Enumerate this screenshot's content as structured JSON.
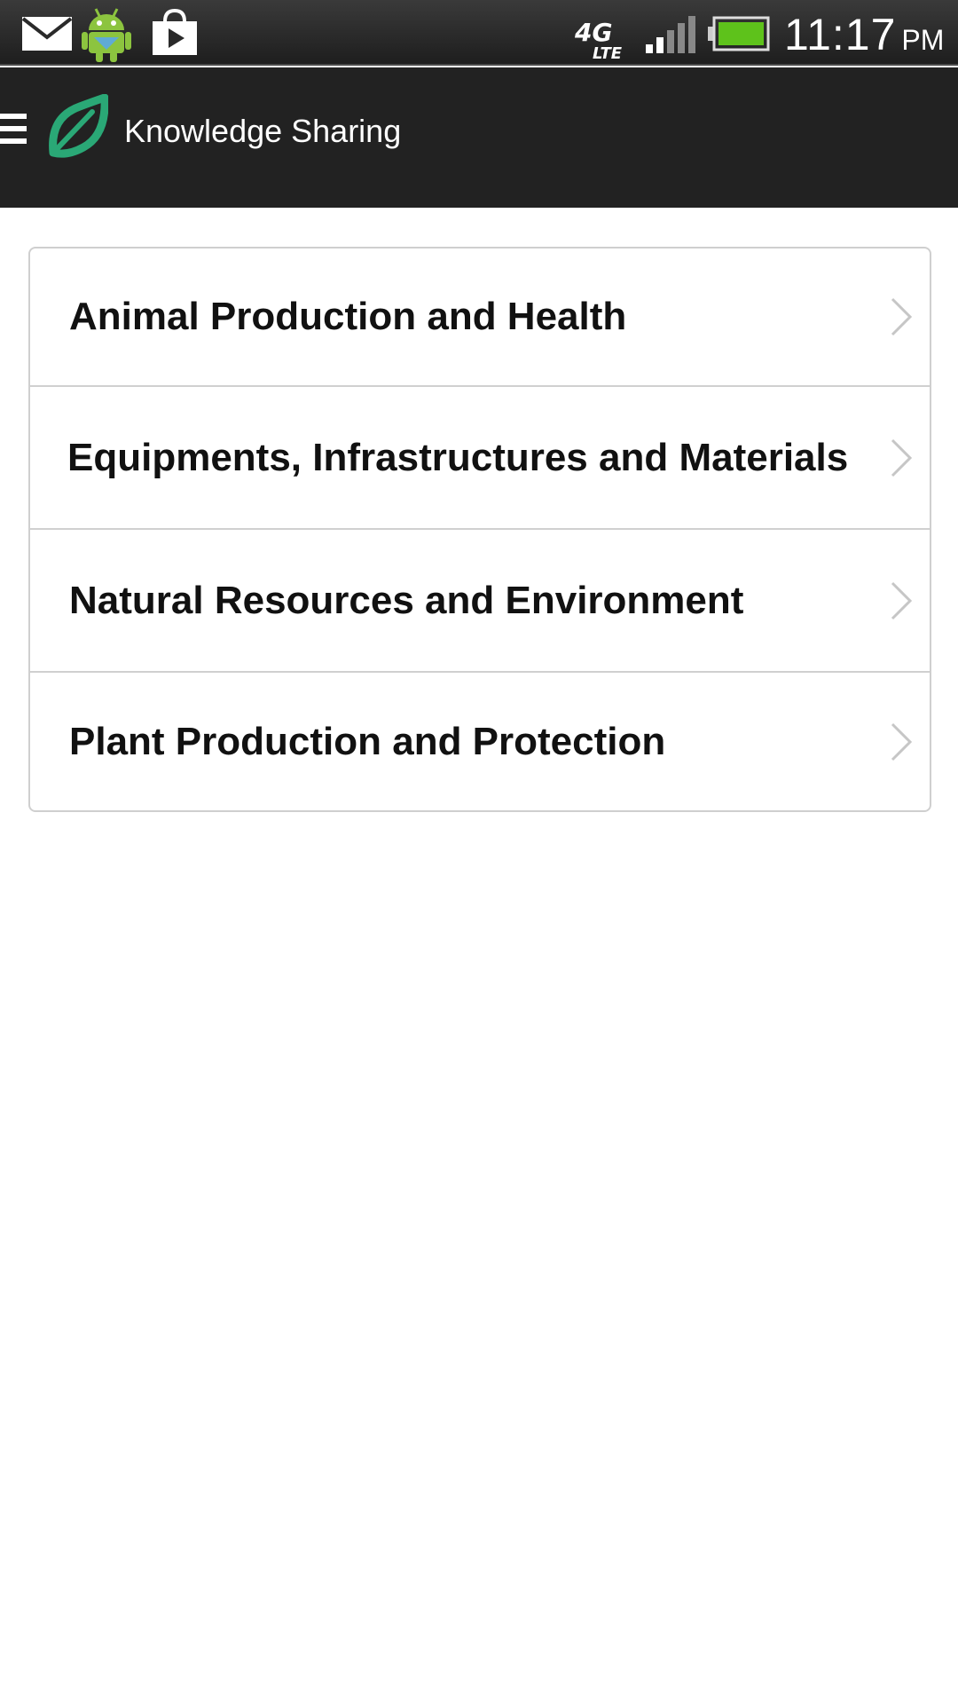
{
  "status_bar": {
    "time": "11:17",
    "ampm": "PM",
    "network": "4G LTE",
    "icons": [
      "mail-icon",
      "android-icon",
      "play-store-icon",
      "lte-icon",
      "signal-icon",
      "battery-icon"
    ]
  },
  "app_bar": {
    "title": "Knowledge Sharing",
    "logo_icon": "leaf-icon",
    "menu_icon": "hamburger-menu-icon"
  },
  "categories": [
    {
      "label": "Animal Production and Health",
      "icon": "chevron-right-icon"
    },
    {
      "label": "Equipments, Infrastructures and Materials",
      "icon": "chevron-right-icon"
    },
    {
      "label": "Natural Resources and Environment",
      "icon": "chevron-right-icon"
    },
    {
      "label": "Plant Production and Protection",
      "icon": "chevron-right-icon"
    }
  ],
  "colors": {
    "status_bar_bg": "#2a2a2a",
    "app_bar_bg": "#222222",
    "accent_green": "#2aa876",
    "battery_green": "#5ec21b",
    "list_border": "#cfcfcf"
  }
}
